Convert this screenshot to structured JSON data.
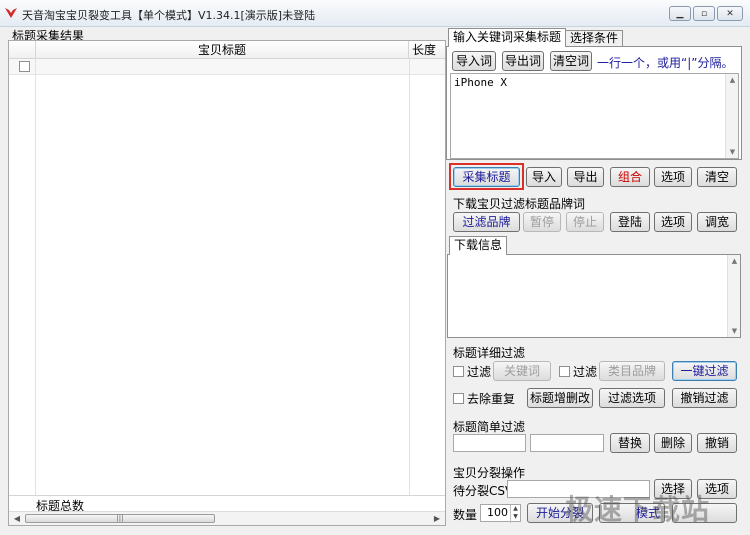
{
  "window": {
    "title": "天音淘宝宝贝裂变工具【单个模式】V1.34.1[演示版]未登陆"
  },
  "left": {
    "section_label": "标题采集结果",
    "columns": [
      "宝贝标题",
      "长度"
    ],
    "footer_label": "标题总数",
    "scroll_grip": "|||"
  },
  "top_tabs": [
    "输入关键词采集标题",
    "选择条件"
  ],
  "keyword": {
    "import_label": "导入词",
    "export_label": "导出词",
    "clear_label": "清空词",
    "hint": "一行一个，或用“|”分隔。",
    "text": "iPhone X"
  },
  "actions": {
    "collect": "采集标题",
    "import": "导入",
    "export": "导出",
    "combine": "组合",
    "options": "选项",
    "clear": "清空"
  },
  "brand": {
    "label": "下载宝贝过滤标题品牌词",
    "filter": "过滤品牌",
    "pause": "暂停",
    "stop": "停止",
    "login": "登陆",
    "options": "选项",
    "wide": "调宽"
  },
  "download_tab": "下载信息",
  "detail": {
    "label": "标题详细过滤",
    "filter1": "过滤",
    "keyword_btn": "关键词",
    "filter2": "过滤",
    "category_btn": "类目品牌",
    "one_key": "一键过滤",
    "dedupe": "去除重复",
    "edit_btn": "标题增删改",
    "filter_opts": "过滤选项",
    "undo": "撤销过滤"
  },
  "simple": {
    "label": "标题简单过滤",
    "replace": "替换",
    "delete": "删除",
    "undo": "撤销"
  },
  "split": {
    "label": "宝贝分裂操作",
    "csv_label": "待分裂CSV",
    "choose1": "选择",
    "choose2": "选项",
    "count_label": "数量",
    "count_value": "100",
    "start": "开始分裂",
    "mode_btn": "模式"
  },
  "watermark": "极速下载站",
  "colors": {
    "accent_red": "#d9302a",
    "link_blue": "#1c1c9a"
  }
}
